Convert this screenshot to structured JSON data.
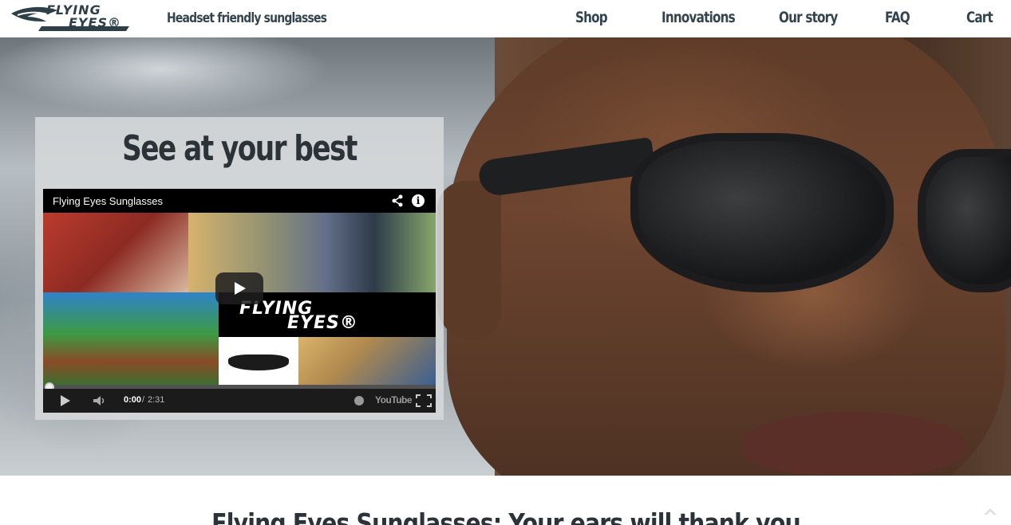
{
  "header": {
    "logo_text_line1": "FLYING",
    "logo_text_line2": "EYES®",
    "tagline": "Headset friendly sunglasses",
    "nav": [
      {
        "label": "Shop"
      },
      {
        "label": "Innovations"
      },
      {
        "label": "Our story"
      },
      {
        "label": "FAQ"
      },
      {
        "label": "Cart"
      }
    ]
  },
  "hero": {
    "heading": "See at your best",
    "video": {
      "title": "Flying Eyes Sunglasses",
      "thumbnail_logo_line1": "FLYING",
      "thumbnail_logo_line2": "EYES®",
      "time_current": "0:00",
      "time_separator": "/",
      "time_total": "2:31",
      "progress": 0.0,
      "youtube_label": "YouTube",
      "icons": [
        "share-icon",
        "info-icon",
        "play-icon",
        "volume-icon",
        "watch-later-icon",
        "fullscreen-icon"
      ]
    }
  },
  "content": {
    "heading": "Flying Eyes Sunglasses: Your ears will thank you"
  },
  "colors": {
    "brand_dark": "#34444e",
    "youtube_red": "#cc181e"
  }
}
